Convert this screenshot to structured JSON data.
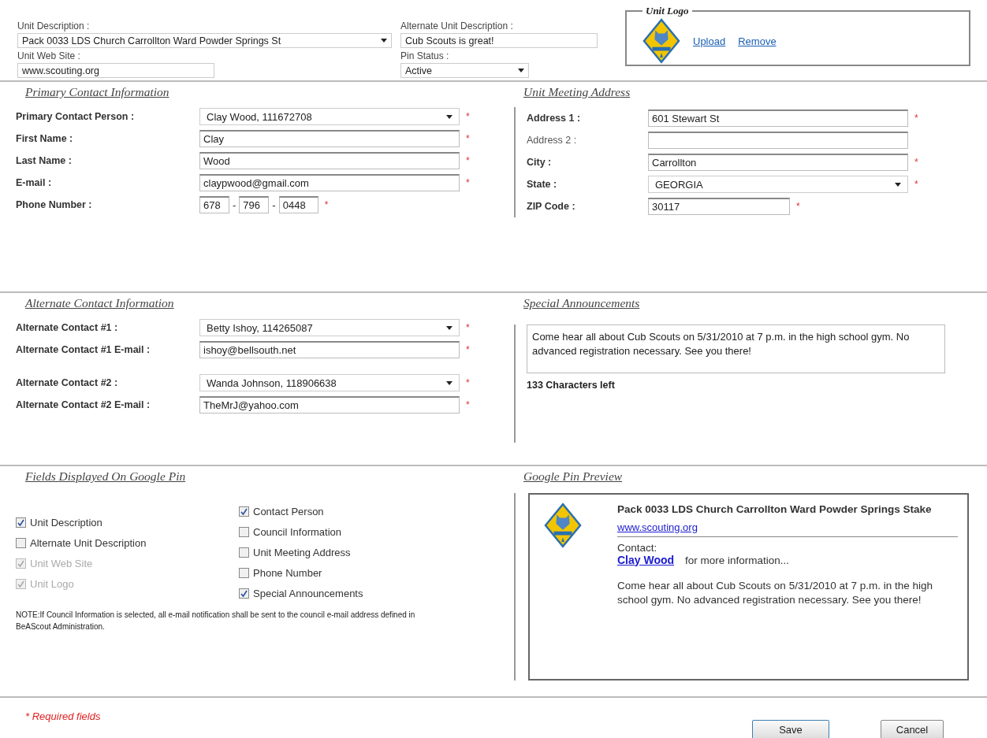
{
  "top": {
    "unit_description": {
      "label": "Unit Description :",
      "value": "Pack 0033 LDS Church Carrollton Ward Powder Springs St"
    },
    "unit_web_site": {
      "label": "Unit Web Site :",
      "value": "www.scouting.org"
    },
    "alternate_unit_description": {
      "label": "Alternate Unit Description :",
      "value": "Cub Scouts is great!"
    },
    "pin_status": {
      "label": "Pin Status :",
      "value": "Active"
    },
    "unit_logo": {
      "legend": "Unit Logo",
      "links": [
        "Upload",
        "Remove"
      ]
    }
  },
  "primary_contact": {
    "title": "Primary Contact Information",
    "fields": [
      {
        "label": "Primary Contact Person :",
        "kind": "select",
        "value": "Clay Wood, 111672708",
        "required_mark": "*"
      },
      {
        "label": "First Name :",
        "kind": "text",
        "value": "Clay",
        "required_mark": "*"
      },
      {
        "label": "Last Name :",
        "kind": "text",
        "value": "Wood",
        "required_mark": "*"
      },
      {
        "label": "E-mail :",
        "kind": "text",
        "value": "claypwood@gmail.com",
        "required_mark": "*"
      },
      {
        "label": "Phone Number :",
        "kind": "phone",
        "parts": [
          "678",
          "796",
          "0448"
        ],
        "separator": "-",
        "required_mark": "*"
      }
    ]
  },
  "meeting_address": {
    "title": "Unit Meeting Address",
    "fields": [
      {
        "label": "Address 1 :",
        "kind": "text",
        "value": "601 Stewart St",
        "required_mark": "*"
      },
      {
        "label": "Address 2 :",
        "kind": "text"
      },
      {
        "label": "City :",
        "kind": "text",
        "value": "Carrollton",
        "required_mark": "*"
      },
      {
        "label": "State :",
        "kind": "select",
        "value": "GEORGIA",
        "required_mark": "*"
      },
      {
        "label": "ZIP Code :",
        "kind": "zip",
        "value": "30117",
        "required_mark": "*"
      }
    ]
  },
  "alternate_contact": {
    "title": "Alternate Contact Information",
    "groups": [
      [
        {
          "label": "Alternate Contact #1 :",
          "kind": "select",
          "value": "Betty Ishoy, 114265087",
          "required_mark": "*"
        },
        {
          "label": "Alternate Contact #1 E-mail :",
          "kind": "text",
          "value": "ishoy@bellsouth.net",
          "required_mark": "*"
        }
      ],
      [
        {
          "label": "Alternate Contact #2 :",
          "kind": "select",
          "value": "Wanda Johnson, 118906638",
          "required_mark": "*"
        },
        {
          "label": "Alternate Contact #2 E-mail :",
          "kind": "text",
          "value": "TheMrJ@yahoo.com",
          "required_mark": "*"
        }
      ]
    ]
  },
  "special_announcements": {
    "title": "Special Announcements",
    "value": "Come hear all about Cub Scouts on 5/31/2010 at 7 p.m. in the high school gym.  No advanced registration necessary.  See you there!",
    "counter": "133 Characters left"
  },
  "pin_fields": {
    "title": "Fields Displayed On Google Pin",
    "columns": [
      [
        {
          "label": "Unit Description",
          "checked": true,
          "disabled": false
        },
        {
          "label": "Alternate Unit Description",
          "checked": false,
          "disabled": false
        },
        {
          "label": "Unit Web Site",
          "checked": true,
          "disabled": true
        },
        {
          "label": "Unit Logo",
          "checked": true,
          "disabled": true
        }
      ],
      [
        {
          "label": "Contact Person",
          "checked": true,
          "disabled": false
        },
        {
          "label": "Council Information",
          "checked": false,
          "disabled": false
        },
        {
          "label": "Unit Meeting Address",
          "checked": false,
          "disabled": false
        },
        {
          "label": "Phone Number",
          "checked": false,
          "disabled": false
        },
        {
          "label": "Special Announcements",
          "checked": true,
          "disabled": false
        }
      ]
    ],
    "note": "NOTE:If Council Information is selected, all e-mail notification shall be sent to the council e-mail address defined in BeAScout Administration."
  },
  "pin_preview": {
    "title": "Google Pin Preview",
    "unit_name": "Pack 0033 LDS Church Carrollton Ward Powder Springs Stake",
    "web_site": "www.scouting.org",
    "contact_label": "Contact:",
    "contact_name": "Clay Wood",
    "contact_suffix": "for more information...",
    "announcement": "Come hear all about Cub Scouts on 5/31/2010 at 7 p.m. in the high school gym. No advanced registration necessary. See you there!"
  },
  "footer": {
    "required_note": "* Required fields",
    "buttons": [
      "Save",
      "Cancel"
    ]
  }
}
